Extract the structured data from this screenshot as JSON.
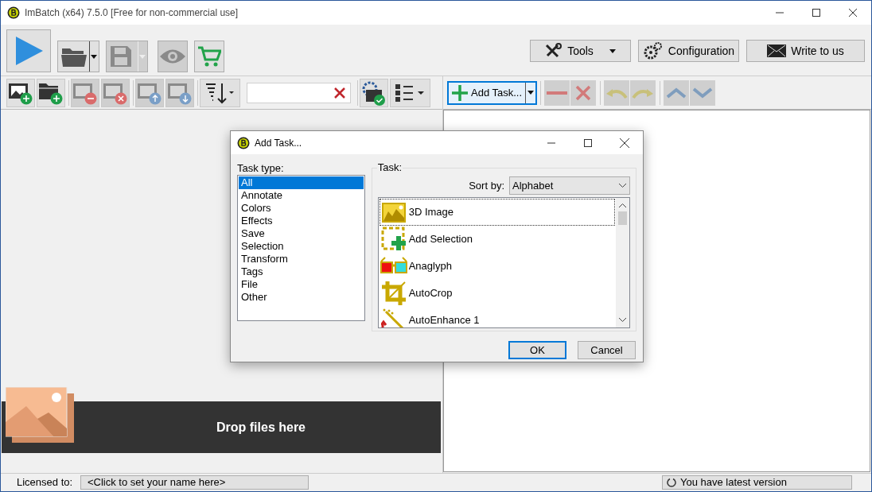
{
  "window": {
    "title": "ImBatch (x64) 7.5.0 [Free for non-commercial use]"
  },
  "main_toolbar": {
    "buttons": [
      {
        "kind": "run",
        "disabled": false
      },
      {
        "kind": "open",
        "disabled": false
      },
      {
        "kind": "save",
        "disabled": true
      },
      {
        "kind": "preview",
        "disabled": true
      },
      {
        "kind": "buy",
        "disabled": false
      }
    ],
    "right_buttons": [
      {
        "kind": "tools",
        "label": "Tools"
      },
      {
        "kind": "configuration",
        "label": "Configuration"
      },
      {
        "kind": "mail",
        "label": "Write to us"
      }
    ]
  },
  "image_toolbar": {
    "buttons": [
      {
        "kind": "add-image",
        "disabled": false
      },
      {
        "kind": "add-folder",
        "disabled": false
      },
      {
        "kind": "remove-image",
        "disabled": true
      },
      {
        "kind": "clear-images",
        "disabled": true
      },
      {
        "kind": "move-up",
        "disabled": true
      },
      {
        "kind": "move-down",
        "disabled": true
      },
      {
        "kind": "sort",
        "disabled": false
      },
      {
        "kind": "search",
        "disabled": false
      },
      {
        "kind": "image-settings",
        "disabled": false
      },
      {
        "kind": "view-list",
        "disabled": false
      }
    ]
  },
  "task_toolbar": {
    "add_task": {
      "label": "Add Task...",
      "focused": true
    },
    "buttons": [
      {
        "kind": "remove",
        "disabled": true
      },
      {
        "kind": "delete",
        "disabled": true
      },
      {
        "kind": "undo",
        "disabled": true
      },
      {
        "kind": "redo",
        "disabled": true
      },
      {
        "kind": "up",
        "disabled": true
      },
      {
        "kind": "down",
        "disabled": true
      }
    ]
  },
  "drop_zone": {
    "text": "Drop files here"
  },
  "dialog": {
    "title": "Add Task...",
    "task_type_label": "Task type:",
    "task_types": [
      {
        "label": "All",
        "selected": true
      },
      {
        "label": "Annotate",
        "selected": false
      },
      {
        "label": "Colors",
        "selected": false
      },
      {
        "label": "Effects",
        "selected": false
      },
      {
        "label": "Save",
        "selected": false
      },
      {
        "label": "Selection",
        "selected": false
      },
      {
        "label": "Transform",
        "selected": false
      },
      {
        "label": "Tags",
        "selected": false
      },
      {
        "label": "File",
        "selected": false
      },
      {
        "label": "Other",
        "selected": false
      }
    ],
    "task_label": "Task:",
    "sort_label": "Sort by:",
    "sort_value": "Alphabet",
    "tasks": [
      {
        "kind": "picture",
        "label": "3D Image",
        "selected": true
      },
      {
        "kind": "selection",
        "label": "Add Selection",
        "selected": false
      },
      {
        "kind": "anaglyph",
        "label": "Anaglyph",
        "selected": false
      },
      {
        "kind": "crop",
        "label": "AutoCrop",
        "selected": false
      },
      {
        "kind": "enhance",
        "label": "AutoEnhance 1",
        "selected": false
      }
    ],
    "ok": "OK",
    "cancel": "Cancel"
  },
  "status_bar": {
    "licensed_label": "Licensed to:",
    "licensed_value": "<Click to set your name here>",
    "version": "You have latest version"
  }
}
